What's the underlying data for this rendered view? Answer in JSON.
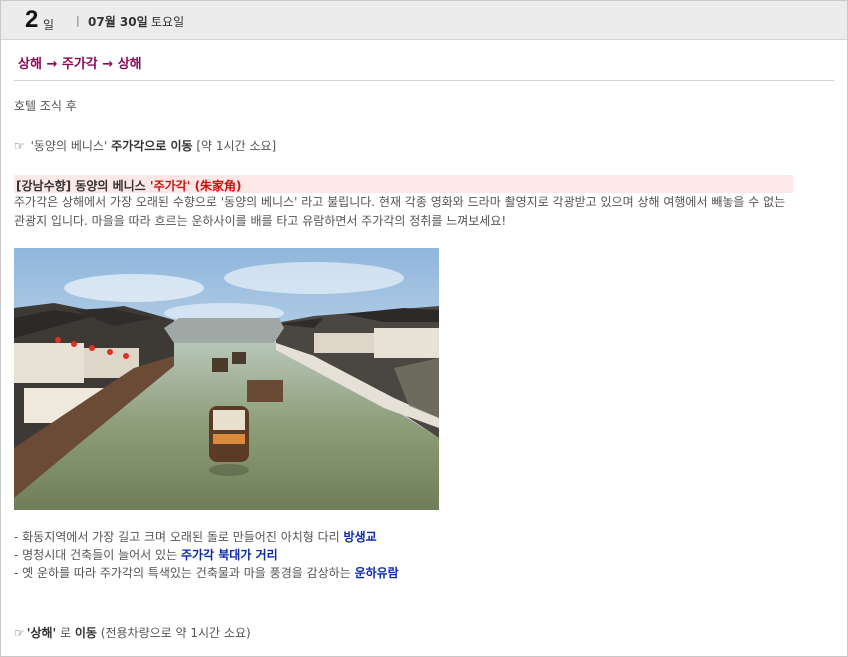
{
  "day_header": {
    "number": "2",
    "unit": "일",
    "separator": "|",
    "date": "07월 30일",
    "weekday": "토요일"
  },
  "route": "상해 → 주가각 → 상해",
  "hotel_note": "호텔 조식 후",
  "move1": {
    "hand": "☞",
    "prefix": "'동양의 베니스'",
    "dest_bold": "주가각으로 이동",
    "duration": "[약 1시간 소요]"
  },
  "highlight": {
    "tag": "[강남수향] 동양의 베니스",
    "red": "'주가각' (朱家角)"
  },
  "description": "주가각은 상해에서 가장 오래된 수향으로 '동양의 베니스' 라고 불립니다. 현재 각종 영화와 드라마 촬영지로 각광받고 있으며 상해 여행에서 빼놓을 수 없는 관광지 입니다. 마을을 따라 흐르는 운하사이를 배를 타고 유람하면서 주가각의 정취를 느껴보세요!",
  "bullets": [
    {
      "text": "- 화동지역에서 가장 길고 크며 오래된 돌로 만들어진 아치형 다리 ",
      "bold": "방생교"
    },
    {
      "text": "- 명청시대 건축들이 늘어서 있는 ",
      "bold": "주가각 북대가 거리"
    },
    {
      "text": "- 옛 운하를 따라 주가각의 특색있는 건축물과 마을 풍경을 감상하는 ",
      "bold": "운하유람"
    }
  ],
  "move2": {
    "hand": "☞",
    "dest_bold": "'상해'",
    "mid": " 로 ",
    "move_bold": "이동",
    "duration": " (전용차량으로 약 1시간 소요)"
  },
  "colors": {
    "route": "#8b0a57",
    "highlight_bg": "#fde8e8",
    "red": "#d01010",
    "blue": "#0b2aa8"
  }
}
